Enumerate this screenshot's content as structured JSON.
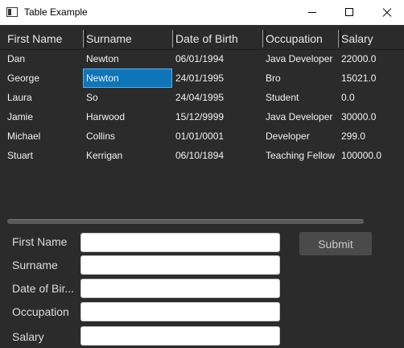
{
  "window": {
    "title": "Table Example"
  },
  "table": {
    "columns": [
      "First Name",
      "Surname",
      "Date of Birth",
      "Occupation",
      "Salary"
    ],
    "rows": [
      [
        "Dan",
        "Newton",
        "06/01/1994",
        "Java Developer",
        "22000.0"
      ],
      [
        "George",
        "Newton",
        "24/01/1995",
        "Bro",
        "15021.0"
      ],
      [
        "Laura",
        "So",
        "24/04/1995",
        "Student",
        "0.0"
      ],
      [
        "Jamie",
        "Harwood",
        "15/12/9999",
        "Java Developer",
        "30000.0"
      ],
      [
        "Michael",
        "Collins",
        "01/01/0001",
        "Developer",
        "299.0"
      ],
      [
        "Stuart",
        "Kerrigan",
        "06/10/1894",
        "Teaching Fellow",
        "100000.0"
      ]
    ],
    "selected_cell": {
      "row": 1,
      "column": 1
    }
  },
  "form": {
    "first_name_label": "First Name",
    "surname_label": "Surname",
    "dob_label": "Date of Bir...",
    "occupation_label": "Occupation",
    "salary_label": "Salary",
    "first_name_value": "",
    "surname_value": "",
    "dob_value": "",
    "occupation_value": "",
    "salary_value": "",
    "submit_label": "Submit"
  },
  "colors": {
    "background": "#2b2b2b",
    "selection": "#0e75b8",
    "submit_button": "#4a4a4a"
  }
}
